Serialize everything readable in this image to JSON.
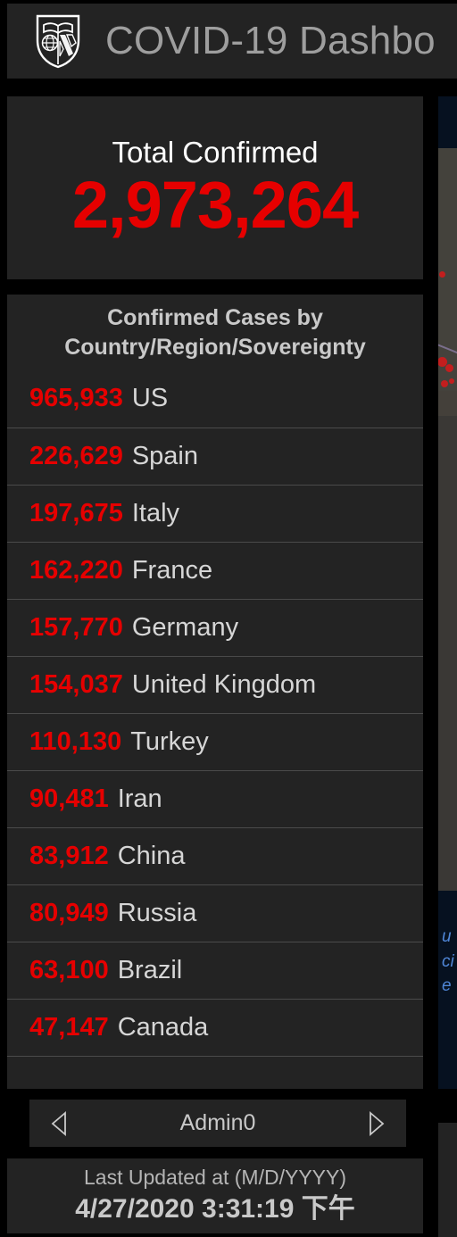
{
  "header": {
    "logo_name": "jhu-shield-logo",
    "title": "COVID-19 Dashbo"
  },
  "total": {
    "label": "Total Confirmed",
    "value": "2,973,264",
    "color": "#e60000"
  },
  "list": {
    "title_line1": "Confirmed Cases by",
    "title_line2": "Country/Region/Sovereignty",
    "rows": [
      {
        "count": "965,933",
        "name": "US"
      },
      {
        "count": "226,629",
        "name": "Spain"
      },
      {
        "count": "197,675",
        "name": "Italy"
      },
      {
        "count": "162,220",
        "name": "France"
      },
      {
        "count": "157,770",
        "name": "Germany"
      },
      {
        "count": "154,037",
        "name": "United Kingdom"
      },
      {
        "count": "110,130",
        "name": "Turkey"
      },
      {
        "count": "90,481",
        "name": "Iran"
      },
      {
        "count": "83,912",
        "name": "China"
      },
      {
        "count": "80,949",
        "name": "Russia"
      },
      {
        "count": "63,100",
        "name": "Brazil"
      },
      {
        "count": "47,147",
        "name": "Canada"
      },
      {
        "count": "",
        "name": ""
      }
    ]
  },
  "pager": {
    "prev_icon": "triangle-left-icon",
    "label": "Admin0",
    "next_icon": "triangle-right-icon"
  },
  "footer": {
    "label": "Last Updated at (M/D/YYYY)",
    "value": "4/27/2020 3:31:19 下午"
  },
  "map": {
    "link_line1": "u",
    "link_line2": "ci",
    "link_line3": "e",
    "marker_color": "#d11b1b",
    "background": "#061120"
  }
}
